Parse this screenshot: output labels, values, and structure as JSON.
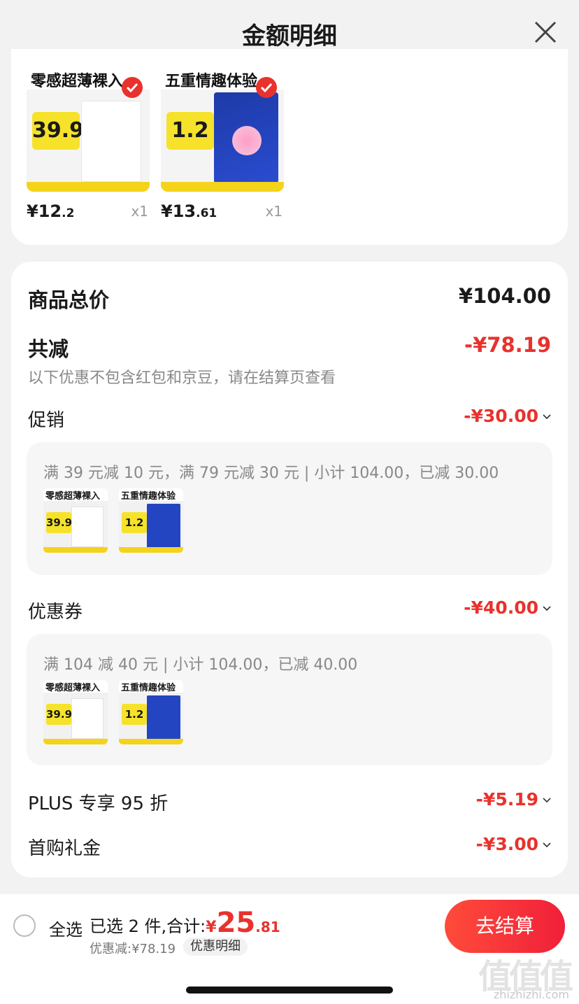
{
  "header": {
    "title": "金额明细"
  },
  "products": [
    {
      "banner": "零感超薄裸入",
      "tag": "39.9",
      "price_int": "¥12",
      "price_dec": ".2",
      "qty": "x1",
      "box": "white"
    },
    {
      "banner": "五重情趣体验",
      "tag": "1.2",
      "price_int": "¥13",
      "price_dec": ".61",
      "qty": "x1",
      "box": "blue"
    }
  ],
  "total": {
    "label": "商品总价",
    "value": "¥104.00"
  },
  "reduce": {
    "label": "共减",
    "value": "-¥78.19",
    "note": "以下优惠不包含红包和京豆，请在结算页查看"
  },
  "promo": {
    "label": "促销",
    "value": "-¥30.00",
    "detail": "满 39 元减 10 元，满 79 元减 30 元 | 小计 104.00，已减 30.00"
  },
  "coupon": {
    "label": "优惠券",
    "value": "-¥40.00",
    "detail": "满 104 减 40 元 | 小计 104.00，已减 40.00"
  },
  "plus": {
    "label": "PLUS 专享 95 折",
    "value": "-¥5.19"
  },
  "firstbuy": {
    "label": "首购礼金",
    "value": "-¥3.00"
  },
  "bottom": {
    "select_all": "全选",
    "summary_prefix": "已选 2 件,合计:",
    "currency": "¥",
    "total_int": "25",
    "total_dec": ".81",
    "discount_text": "优惠减:¥78.19",
    "detail_button": "优惠明细",
    "checkout_button": "去结算"
  },
  "watermark": {
    "big": "值值值",
    "small": "zhizhizhi.com"
  },
  "colors": {
    "accent_red": "#e8322d",
    "yellow": "#f4d31b"
  }
}
